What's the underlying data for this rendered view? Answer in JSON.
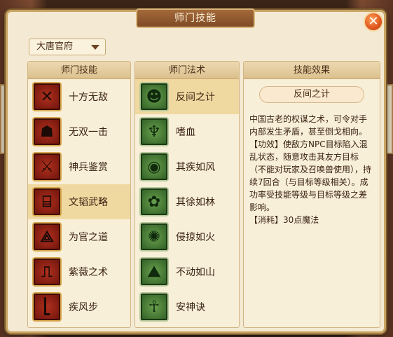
{
  "window": {
    "title": "师门技能",
    "close_label": "✕"
  },
  "faction_dropdown": {
    "selected": "大唐官府"
  },
  "columns": {
    "skills_header": "师门技能",
    "spells_header": "师门法术",
    "effect_header": "技能效果"
  },
  "skills": [
    {
      "label": "十方无敌",
      "icon": "crossed-swords-icon",
      "glyph": "✕"
    },
    {
      "label": "无双一击",
      "icon": "demon-mask-icon",
      "glyph": "☗"
    },
    {
      "label": "神兵鉴赏",
      "icon": "weapon-rack-icon",
      "glyph": "⚔"
    },
    {
      "label": "文韬武略",
      "icon": "gate-icon",
      "glyph": "⌸"
    },
    {
      "label": "为官之道",
      "icon": "glyph-icon",
      "glyph": "⟁"
    },
    {
      "label": "紫薇之术",
      "icon": "frame-icon",
      "glyph": "⎍"
    },
    {
      "label": "疾风步",
      "icon": "bracket-icon",
      "glyph": "⎣"
    }
  ],
  "spells": [
    {
      "label": "反间之计",
      "icon": "two-heads-icon",
      "glyph": "☻"
    },
    {
      "label": "嗜血",
      "icon": "fanged-mouth-icon",
      "glyph": "♆"
    },
    {
      "label": "其疾如风",
      "icon": "wind-seal-icon",
      "glyph": "◉"
    },
    {
      "label": "其徐如林",
      "icon": "forest-seal-icon",
      "glyph": "✿"
    },
    {
      "label": "侵掠如火",
      "icon": "fire-burst-icon",
      "glyph": "✺"
    },
    {
      "label": "不动如山",
      "icon": "mountain-seal-icon",
      "glyph": "⛰"
    },
    {
      "label": "安神诀",
      "icon": "monk-figure-icon",
      "glyph": "☥"
    }
  ],
  "selected_skill_index": 3,
  "selected_spell_index": 0,
  "effect": {
    "name": "反间之计",
    "description": "中国古老的权谋之术，可令对手内部发生矛盾，甚至倒戈相向。",
    "effect_line": "【功效】使敌方NPC目标陷入混乱状态，随意攻击其友方目标（不能对玩家及召唤兽使用），持续7回合（与目标等级相关）。成功率受技能等级与目标等级之差影响。",
    "cost_line": "【消耗】30点魔法"
  }
}
